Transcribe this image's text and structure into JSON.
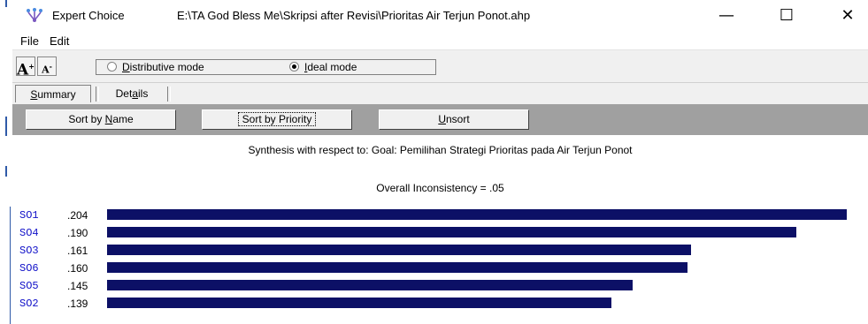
{
  "window": {
    "app_name": "Expert Choice",
    "file_path": "E:\\TA God Bless Me\\Skripsi after Revisi\\Prioritas Air Terjun Ponot.ahp",
    "minimize_glyph": "—",
    "maximize_glyph": "☐",
    "close_glyph": "✕"
  },
  "menu": {
    "file": "File",
    "edit": "Edit"
  },
  "toolbar": {
    "font_increase": "A",
    "font_decrease": "A",
    "distributive_label_pre": "",
    "distributive_label_u": "D",
    "distributive_label_post": "istributive mode",
    "ideal_label_u": "I",
    "ideal_label_post": "deal mode",
    "selected_mode": "ideal"
  },
  "tabs": {
    "summary_u": "S",
    "summary_post": "ummary",
    "details_pre": "Det",
    "details_u": "a",
    "details_post": "ils",
    "active": "summary"
  },
  "sort": {
    "by_name_pre": "Sort by ",
    "by_name_u": "N",
    "by_name_post": "ame",
    "by_priority": "Sort by Priority",
    "unsort_u": "U",
    "unsort_post": "nsort"
  },
  "synthesis_text": "Synthesis with respect to: Goal: Pemilihan Strategi Prioritas pada Air Terjun Ponot",
  "inconsistency_text": "Overall Inconsistency = .05",
  "priority_bar_color": "#0c1066",
  "alternatives": [
    {
      "name": "SO1",
      "value_label": ".204",
      "value": 0.204
    },
    {
      "name": "SO4",
      "value_label": ".190",
      "value": 0.19
    },
    {
      "name": "SO3",
      "value_label": ".161",
      "value": 0.161
    },
    {
      "name": "SO6",
      "value_label": ".160",
      "value": 0.16
    },
    {
      "name": "SO5",
      "value_label": ".145",
      "value": 0.145
    },
    {
      "name": "SO2",
      "value_label": ".139",
      "value": 0.139
    }
  ]
}
